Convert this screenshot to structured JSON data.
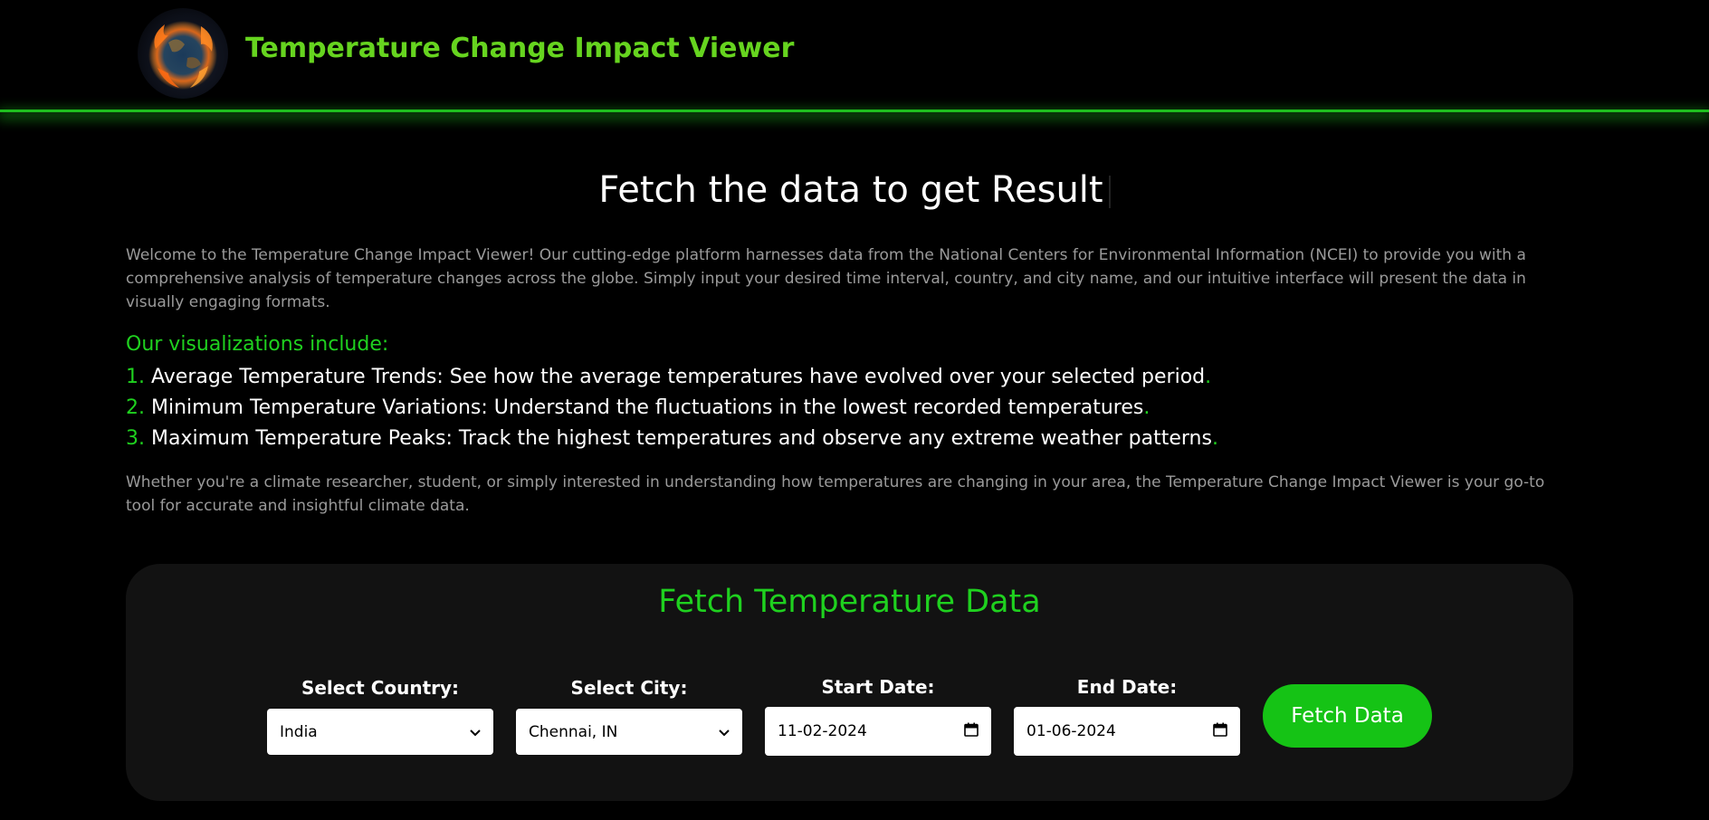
{
  "header": {
    "logo_icon": "burning-earth-logo",
    "title": "Temperature Change Impact Viewer"
  },
  "hero": {
    "title": "Fetch the data to get Result"
  },
  "intro": {
    "paragraph": "Welcome to the Temperature Change Impact Viewer! Our cutting-edge platform harnesses data from the National Centers for Environmental Information (NCEI) to provide you with a comprehensive analysis of temperature changes across the globe. Simply input your desired time interval, country, and city name, and our intuitive interface will present the data in visually engaging formats."
  },
  "visualizations": {
    "heading": "Our visualizations include:",
    "items": [
      {
        "num": "1.",
        "text": "Average Temperature Trends: See how the average temperatures have evolved over your selected period",
        "end": "."
      },
      {
        "num": "2.",
        "text": "Minimum Temperature Variations: Understand the fluctuations in the lowest recorded temperatures",
        "end": "."
      },
      {
        "num": "3.",
        "text": "Maximum Temperature Peaks: Track the highest temperatures and observe any extreme weather patterns",
        "end": "."
      }
    ]
  },
  "closing": {
    "paragraph": "Whether you're a climate researcher, student, or simply interested in understanding how temperatures are changing in your area, the Temperature Change Impact Viewer is your go-to tool for accurate and insightful climate data."
  },
  "form": {
    "title": "Fetch Temperature Data",
    "country": {
      "label": "Select Country:",
      "value": "India"
    },
    "city": {
      "label": "Select City:",
      "value": "Chennai, IN"
    },
    "start_date": {
      "label": "Start Date:",
      "value": "11-02-2024"
    },
    "end_date": {
      "label": "End Date:",
      "value": "01-06-2024"
    },
    "submit_label": "Fetch Data"
  },
  "colors": {
    "accent_green": "#1fd11f",
    "title_green": "#66d41f",
    "button_green": "#15c315",
    "panel_bg": "#121212"
  }
}
